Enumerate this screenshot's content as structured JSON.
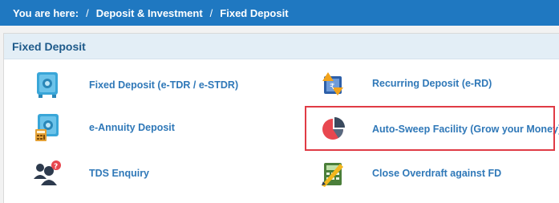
{
  "breadcrumb": {
    "prefix": "You are here:",
    "items": [
      "Deposit & Investment",
      "Fixed Deposit"
    ],
    "separator": "/"
  },
  "panel": {
    "title": "Fixed Deposit",
    "items": [
      {
        "label": "Fixed Deposit (e-TDR / e-STDR)",
        "icon": "safe-icon"
      },
      {
        "label": "Recurring Deposit (e-RD)",
        "icon": "recurring-arrows-icon"
      },
      {
        "label": "e-Annuity Deposit",
        "icon": "safe-calculator-icon"
      },
      {
        "label": "Auto-Sweep Facility (Grow your Money)",
        "icon": "pie-chart-icon"
      },
      {
        "label": "TDS Enquiry",
        "icon": "people-question-icon"
      },
      {
        "label": "Close Overdraft against FD",
        "icon": "calculator-pen-icon"
      }
    ]
  },
  "colors": {
    "breadcrumb_bg": "#1f78c1",
    "panel_header_bg": "#e3eef6",
    "link": "#2f78b8",
    "highlight": "#e03b45"
  }
}
